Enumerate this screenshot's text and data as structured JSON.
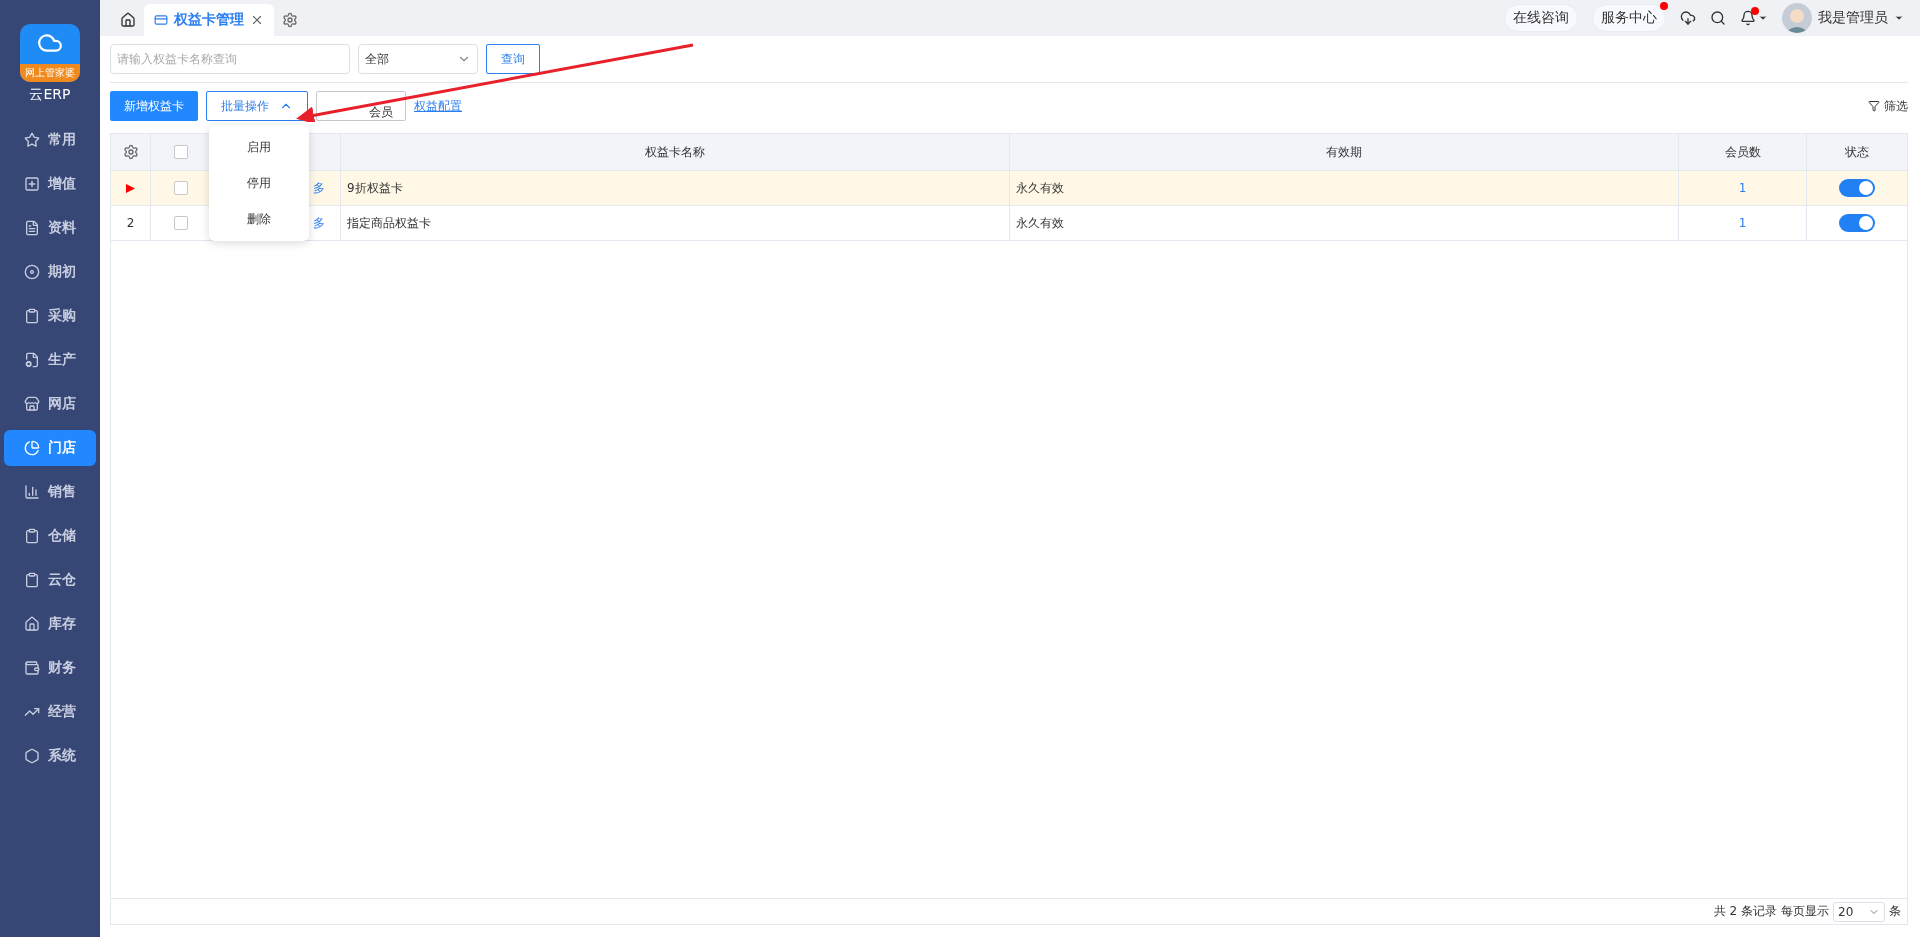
{
  "sidebar": {
    "logo_badge": "网上管家婆",
    "logo_text": "云ERP",
    "items": [
      {
        "label": "常用",
        "selected": false
      },
      {
        "label": "增值",
        "selected": false
      },
      {
        "label": "资料",
        "selected": false
      },
      {
        "label": "期初",
        "selected": false
      },
      {
        "label": "采购",
        "selected": false
      },
      {
        "label": "生产",
        "selected": false
      },
      {
        "label": "网店",
        "selected": false
      },
      {
        "label": "门店",
        "selected": true
      },
      {
        "label": "销售",
        "selected": false
      },
      {
        "label": "仓储",
        "selected": false
      },
      {
        "label": "云仓",
        "selected": false
      },
      {
        "label": "库存",
        "selected": false
      },
      {
        "label": "财务",
        "selected": false
      },
      {
        "label": "经营",
        "selected": false
      },
      {
        "label": "系统",
        "selected": false
      }
    ]
  },
  "tabs": [
    {
      "label": "权益卡管理",
      "selected": true
    }
  ],
  "header": {
    "buttons": [
      {
        "label": "在线咨询",
        "notice": false
      },
      {
        "label": "服务中心",
        "notice": true
      }
    ],
    "bell_notice": true,
    "user": "我是管理员"
  },
  "search": {
    "placeholder": "请输入权益卡名称查询",
    "status": "全部",
    "query_button": "查询"
  },
  "toolbar": {
    "add_button": "新增权益卡",
    "batch_button": "批量操作",
    "issue_button": "会员",
    "config_link": "权益配置",
    "filter": "筛选"
  },
  "batch_menu": {
    "expanded": true,
    "items": [
      "启用",
      "停用",
      "删除"
    ]
  },
  "table": {
    "header_checked": false,
    "columns": [
      "权益卡名称",
      "有效期",
      "会员数",
      "状态"
    ],
    "rows": [
      {
        "current": true,
        "checked": false,
        "action": "多",
        "name": "9折权益卡",
        "validity": "永久有效",
        "members": "1",
        "on": true
      },
      {
        "current": false,
        "index": "2",
        "checked": false,
        "action": "多",
        "name": "指定商品权益卡",
        "validity": "永久有效",
        "members": "1",
        "on": true
      }
    ]
  },
  "pagination": {
    "total": "共 2 条记录",
    "per_page_label": "每页显示",
    "page_size": "20",
    "unit": "条"
  }
}
